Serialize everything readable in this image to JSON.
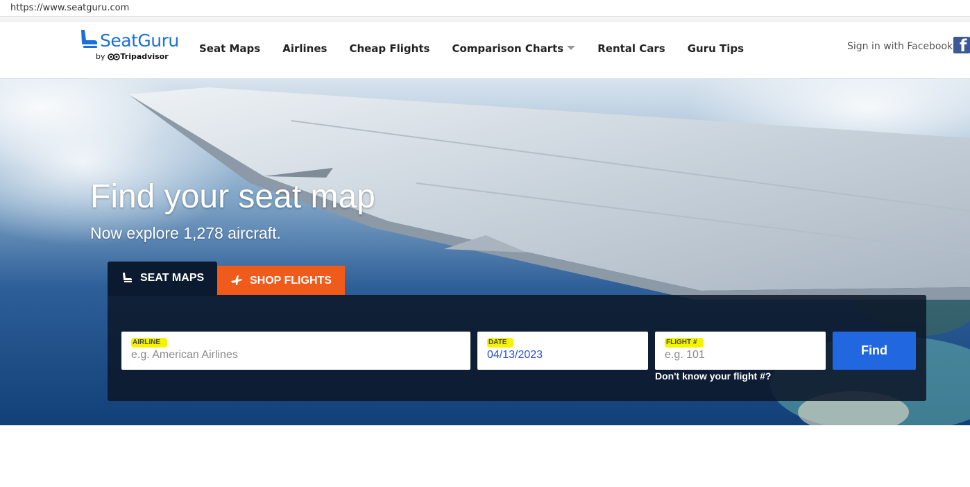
{
  "browser": {
    "url": "https://www.seatguru.com"
  },
  "header": {
    "logo_text": "SeatGuru",
    "logo_by": "by",
    "logo_brand": "Tripadvisor",
    "nav": [
      "Seat Maps",
      "Airlines",
      "Cheap Flights",
      "Comparison Charts",
      "Rental Cars",
      "Guru Tips"
    ],
    "signin_label": "Sign in with Facebook",
    "facebook_glyph": "f"
  },
  "hero": {
    "title": "Find your seat map",
    "subtitle": "Now explore 1,278 aircraft."
  },
  "tabs": {
    "seat_maps": "SEAT MAPS",
    "shop_flights": "SHOP FLIGHTS"
  },
  "search": {
    "airline_label": "AIRLINE",
    "airline_placeholder": "e.g. American Airlines",
    "date_label": "DATE",
    "date_value": "04/13/2023",
    "flight_label": "FLIGHT #",
    "flight_placeholder": "e.g. 101",
    "dont_know": "Don't know your flight #?",
    "find_label": "Find"
  },
  "icons": {
    "logo": "seat-icon",
    "tab_seat": "seat-icon",
    "tab_shop": "airplane-icon",
    "caret": "chevron-down-icon",
    "facebook": "facebook-icon"
  },
  "colors": {
    "brand_blue": "#1a6fd8",
    "shop_orange": "#f05a1a",
    "find_blue": "#2167e0",
    "panel_dark": "#0c1628",
    "highlight_yellow": "#f4f400",
    "facebook_blue": "#3b5998"
  }
}
